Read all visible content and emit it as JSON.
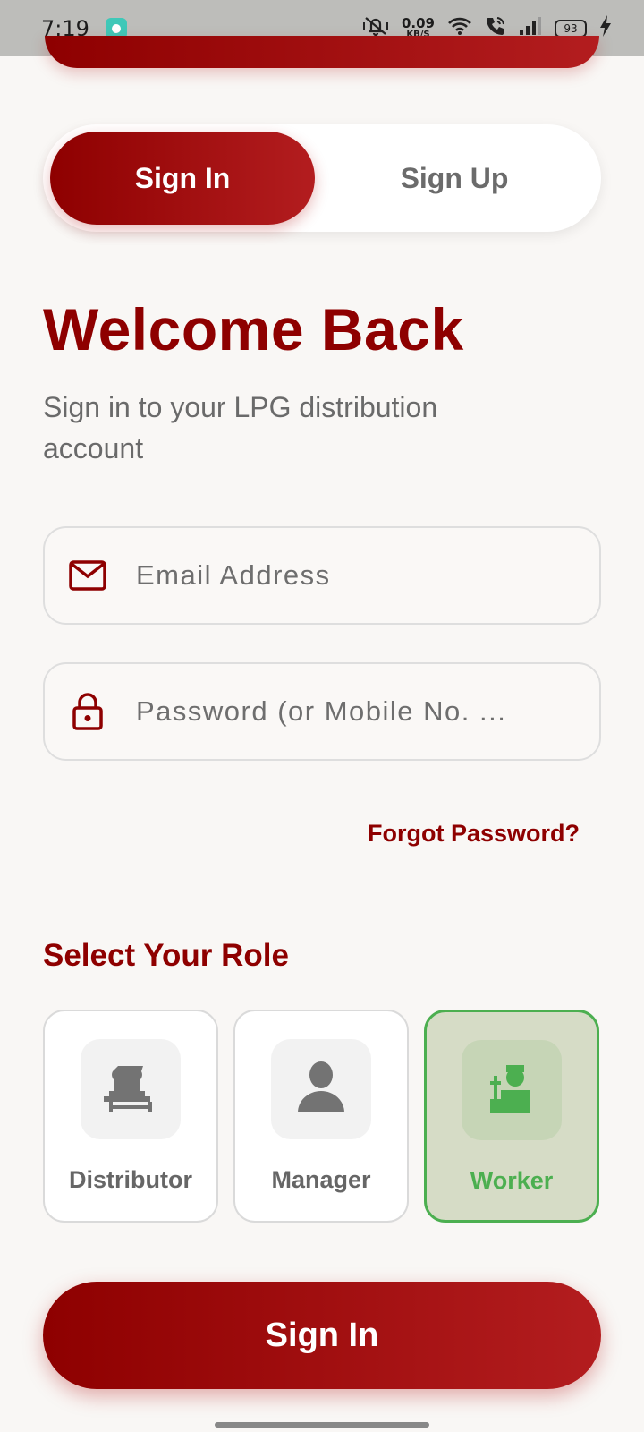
{
  "status_bar": {
    "time": "7:19",
    "net_speed_value": "0.09",
    "net_speed_unit": "KB/S",
    "battery": "93"
  },
  "tabs": [
    {
      "label": "Sign In",
      "active": true
    },
    {
      "label": "Sign Up",
      "active": false
    }
  ],
  "header": {
    "title": "Welcome Back",
    "subtitle": "Sign in to your LPG distribution account"
  },
  "form": {
    "email": {
      "placeholder": "Email Address",
      "value": "",
      "icon": "mail-icon"
    },
    "password": {
      "placeholder": "Password (or Mobile No. ...",
      "value": "",
      "icon": "lock-icon"
    },
    "forgot_label": "Forgot Password?"
  },
  "roles": {
    "heading": "Select Your Role",
    "items": [
      {
        "label": "Distributor",
        "icon": "distributor-icon",
        "selected": false
      },
      {
        "label": "Manager",
        "icon": "manager-icon",
        "selected": false
      },
      {
        "label": "Worker",
        "icon": "worker-icon",
        "selected": true
      }
    ]
  },
  "submit": {
    "label": "Sign In"
  },
  "colors": {
    "primary": "#8e0000",
    "primary_light": "#b31d1f",
    "selected_green": "#4caf50",
    "background": "#f9f7f5"
  }
}
